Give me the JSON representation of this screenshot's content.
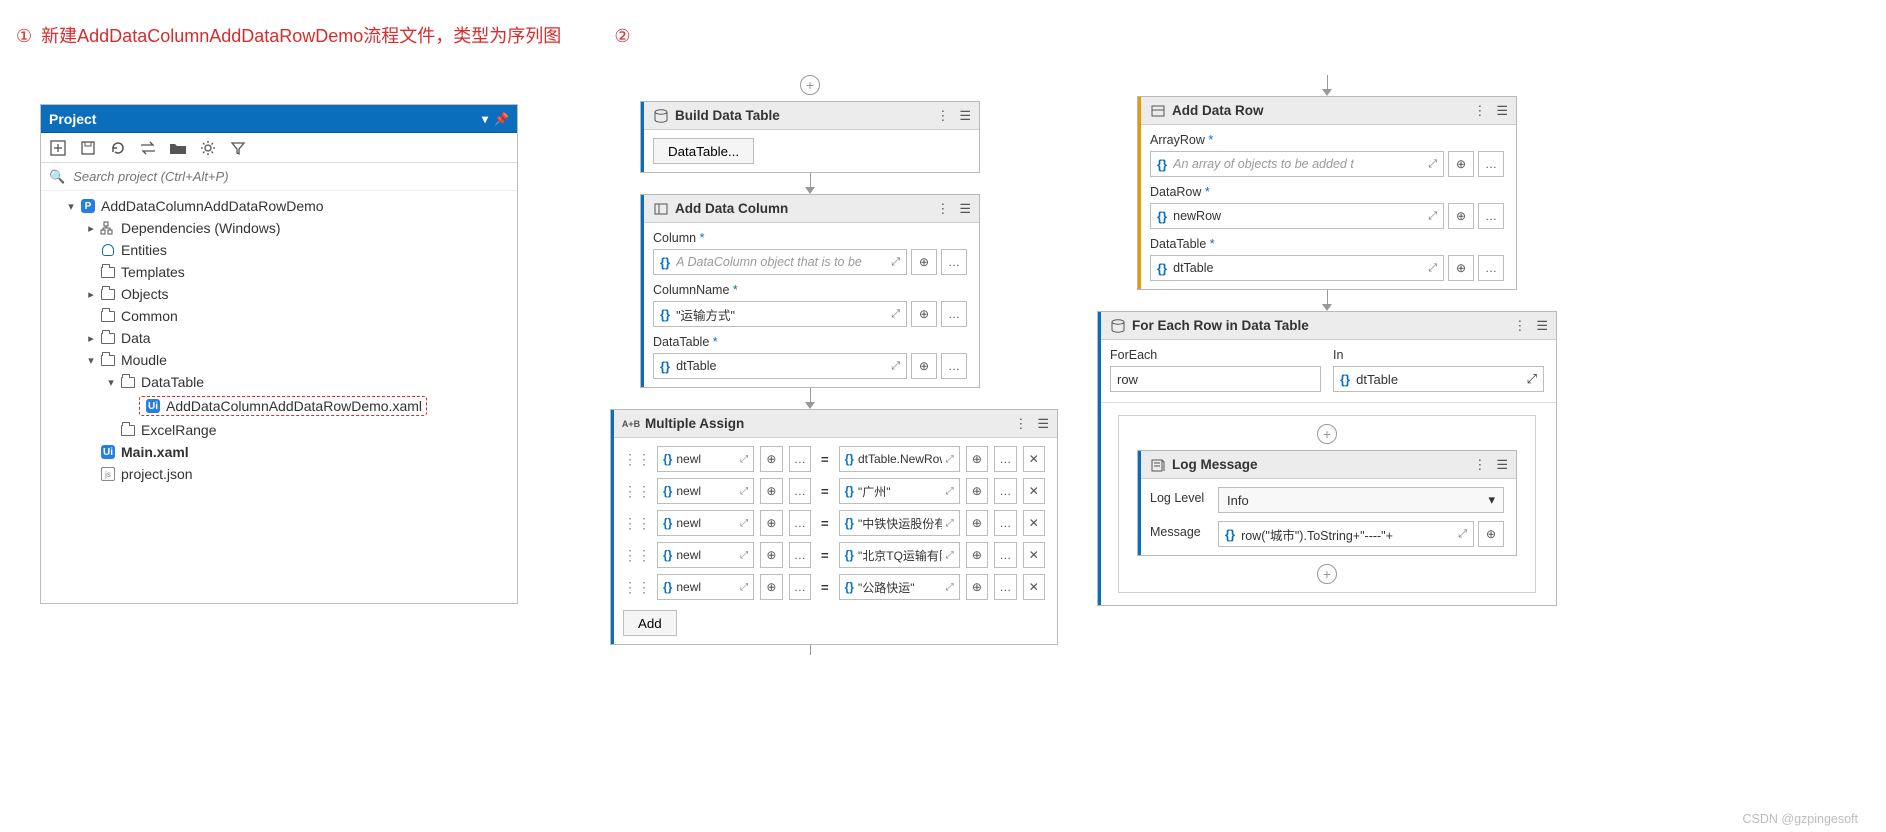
{
  "annotation": {
    "step1": "①",
    "text": "新建AddDataColumnAddDataRowDemo流程文件，类型为序列图",
    "step2": "②"
  },
  "project_panel": {
    "title": "Project",
    "search_placeholder": "Search project (Ctrl+Alt+P)",
    "root": "AddDataColumnAddDataRowDemo",
    "dependencies": "Dependencies (Windows)",
    "entities": "Entities",
    "templates": "Templates",
    "objects": "Objects",
    "common": "Common",
    "data": "Data",
    "moudle": "Moudle",
    "datatable_folder": "DataTable",
    "demo_file": "AddDataColumnAddDataRowDemo.xaml",
    "excel_range": "ExcelRange",
    "main": "Main.xaml",
    "project_json": "project.json"
  },
  "workflow": {
    "build_dt": {
      "title": "Build Data Table",
      "button": "DataTable..."
    },
    "add_col": {
      "title": "Add Data Column",
      "column_label": "Column",
      "column_placeholder": "A DataColumn object that is to be",
      "colname_label": "ColumnName",
      "colname_value": "\"运输方式\"",
      "dt_label": "DataTable",
      "dt_value": "dtTable"
    },
    "multi_assign": {
      "title": "Multiple Assign",
      "rows": [
        {
          "l": "newl",
          "r": "dtTable.NewRow"
        },
        {
          "l": "newl",
          "r": "\"广州\""
        },
        {
          "l": "newl",
          "r": "\"中铁快运股份有限"
        },
        {
          "l": "newl",
          "r": "\"北京TQ运输有限公"
        },
        {
          "l": "newl",
          "r": "\"公路快运\""
        }
      ],
      "add_label": "Add"
    },
    "add_row": {
      "title": "Add Data Row",
      "array_label": "ArrayRow",
      "array_placeholder": "An array of objects to be added t",
      "datarow_label": "DataRow",
      "datarow_value": "newRow",
      "dt_label": "DataTable",
      "dt_value": "dtTable"
    },
    "foreach": {
      "title": "For Each Row in Data Table",
      "foreach_label": "ForEach",
      "foreach_value": "row",
      "in_label": "In",
      "in_value": "dtTable"
    },
    "log": {
      "title": "Log Message",
      "level_label": "Log Level",
      "level_value": "Info",
      "msg_label": "Message",
      "msg_value": "row(\"城市\").ToString+\"----\"+"
    }
  },
  "watermark": "CSDN @gzpingesoft"
}
